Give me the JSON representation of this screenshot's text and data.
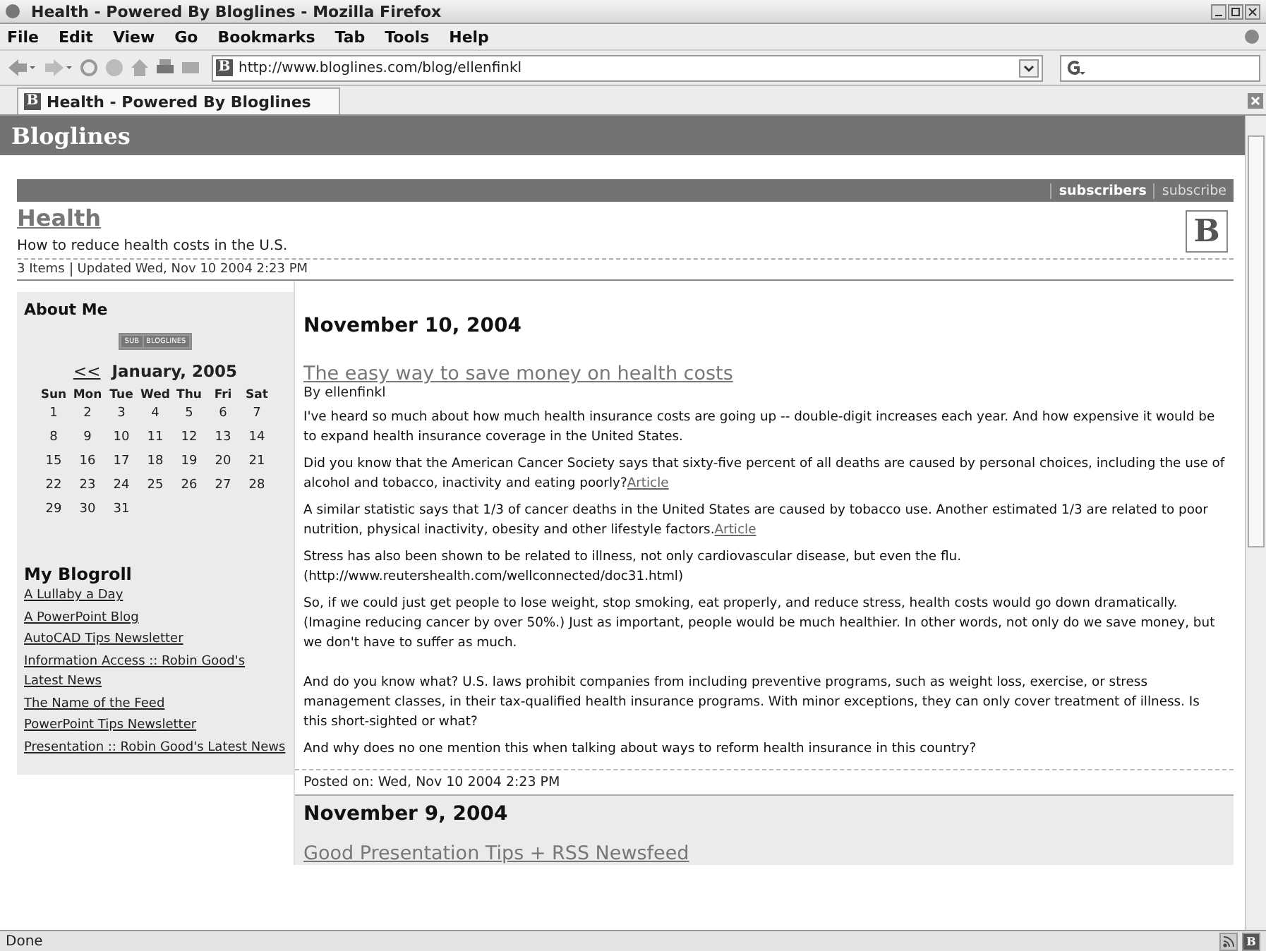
{
  "window": {
    "title": "Health - Powered By Bloglines - Mozilla Firefox"
  },
  "menu": [
    "File",
    "Edit",
    "View",
    "Go",
    "Bookmarks",
    "Tab",
    "Tools",
    "Help"
  ],
  "address": {
    "favicon": "B",
    "value": "http://www.bloglines.com/blog/ellenfinkl"
  },
  "tabs": [
    {
      "favicon": "B",
      "label": "Health - Powered By Bloglines",
      "selected": true
    }
  ],
  "site": {
    "name": "Bloglines",
    "logo": "B",
    "links": [
      {
        "label": "subscribers",
        "selected": true
      },
      {
        "label": "subscribe",
        "selected": false
      }
    ],
    "blog_title": "Health",
    "description": "How to reduce health costs in the U.S.",
    "items": "3 Items",
    "updated": "Updated Wed, Nov 10 2004 2:23 PM"
  },
  "sidebar": {
    "about": "About Me",
    "badge": [
      "SUB",
      "BLOGLINES"
    ],
    "calendar": {
      "prev": "<<",
      "month": "January, 2005",
      "days": [
        "Sun",
        "Mon",
        "Tue",
        "Wed",
        "Thu",
        "Fri",
        "Sat"
      ],
      "weeks": [
        [
          "1",
          "2",
          "3",
          "4",
          "5",
          "6",
          "7"
        ],
        [
          "8",
          "9",
          "10",
          "11",
          "12",
          "13",
          "14"
        ],
        [
          "15",
          "16",
          "17",
          "18",
          "19",
          "20",
          "21"
        ],
        [
          "22",
          "23",
          "24",
          "25",
          "26",
          "27",
          "28"
        ],
        [
          "29",
          "30",
          "31"
        ]
      ]
    },
    "blogroll_title": "My Blogroll",
    "blogroll": [
      "A Lullaby a Day",
      "A PowerPoint Blog",
      "AutoCAD Tips Newsletter",
      "Information Access :: Robin Good's Latest News",
      "The Name of the Feed",
      "PowerPoint Tips Newsletter",
      "Presentation :: Robin Good's Latest News"
    ]
  },
  "posts": [
    {
      "date": "November 10, 2004",
      "title": "The easy way to save money on health costs",
      "author": "By ellenfinkl",
      "paragraphs": [
        {
          "text": "I've heard so much about how much health insurance costs are going up -- double-digit increases each year. And how expensive it would be to expand health insurance coverage in the United States."
        },
        {
          "text": "Did you know that the American Cancer Society says that sixty-five percent of all deaths are caused by personal choices, including the use of alcohol and tobacco, inactivity and eating poorly?",
          "link": "Article"
        },
        {
          "text": "A similar statistic says that 1/3 of cancer deaths in the United States are caused by tobacco use. Another estimated 1/3 are related to poor nutrition, physical inactivity, obesity and other lifestyle factors.",
          "link": "Article"
        },
        {
          "text": "Stress has also been shown to be related to illness, not only cardiovascular disease, but even the flu. (http://www.reutershealth.com/wellconnected/doc31.html)"
        },
        {
          "text": "So, if we could just get people to lose weight, stop smoking, eat properly, and reduce stress, health costs would go down dramatically. (Imagine reducing cancer by over 50%.) Just as important, people would be much healthier. In other words, not only do we save money, but we don't have to suffer as much."
        },
        {
          "text": "And do you know what? U.S. laws prohibit companies from including preventive programs, such as weight loss, exercise, or stress management classes, in their tax-qualified health insurance programs. With minor exceptions, they can only cover treatment of illness. Is this short-sighted or what?"
        },
        {
          "text": "And why does no one mention this when talking about ways to reform health insurance in this country?"
        }
      ],
      "posted": "Posted on: Wed, Nov 10 2004 2:23 PM"
    },
    {
      "date": "November 9, 2004",
      "title": "Good Presentation Tips + RSS Newsfeed"
    }
  ],
  "status_bar": {
    "text": "Done",
    "icon": "B"
  }
}
